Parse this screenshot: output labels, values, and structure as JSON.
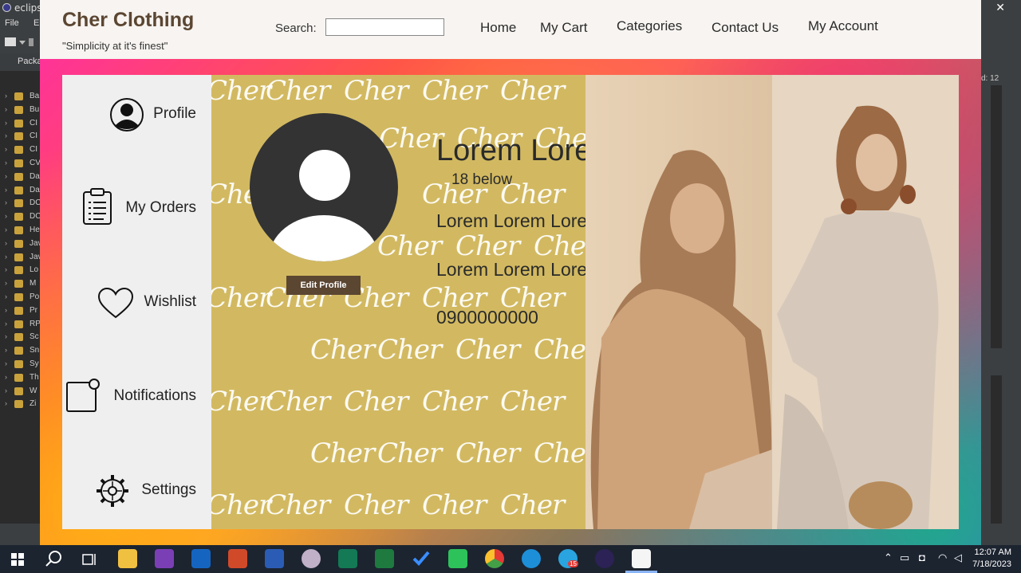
{
  "ide": {
    "title": "eclips",
    "menu": [
      "File",
      "E"
    ],
    "package_header": "Packa",
    "tree_items": [
      "Ba",
      "Bu",
      "CI",
      "CI",
      "CI",
      "CV",
      "Da",
      "Da",
      "DC",
      "DC",
      "He",
      "Jav",
      "Jav",
      "Lo",
      "M",
      "Po",
      "Pr",
      "RP",
      "Sc",
      "Sn",
      "Sy",
      "Th",
      "W",
      "Zi"
    ],
    "right_label": "d: 12",
    "close_glyph": "✕"
  },
  "app": {
    "brand_name": "Cher Clothing",
    "tagline": "\"Simplicity at it's finest\"",
    "search": {
      "label": "Search:",
      "value": "",
      "placeholder": ""
    },
    "nav": {
      "home": "Home",
      "cart": "My Cart",
      "categories": "Categories",
      "contact": "Contact Us",
      "account": "My Account"
    },
    "sidebar": {
      "profile": "Profile",
      "orders": "My Orders",
      "wishlist": "Wishlist",
      "notifications": "Notifications",
      "settings": "Settings"
    },
    "watermark": "Cher",
    "profile": {
      "edit_button": "Edit Profile",
      "name": "Lorem  Lorem",
      "age": "18 below",
      "line1": "Lorem Lorem Lorem Lorem",
      "line2": "Lorem Lorem Lorem Lorem",
      "phone": "0900000000"
    },
    "colors": {
      "brand": "#5b4632",
      "panel": "#d2b961",
      "sidebar": "#efefef",
      "header": "#f7f4f1"
    }
  },
  "taskbar": {
    "time": "12:07 AM",
    "date": "7/18/2023",
    "telegram_badge": "15",
    "apps": [
      "start-icon",
      "search-icon",
      "task-view-icon",
      "file-explorer-icon",
      "onenote-icon",
      "outlook-icon",
      "powerpoint-icon",
      "word-icon",
      "paint-icon",
      "publisher-icon",
      "excel-icon",
      "todo-icon",
      "whatsapp-icon",
      "chrome-icon",
      "edge-icon",
      "telegram-icon",
      "eclipse-icon",
      "java-icon"
    ]
  }
}
